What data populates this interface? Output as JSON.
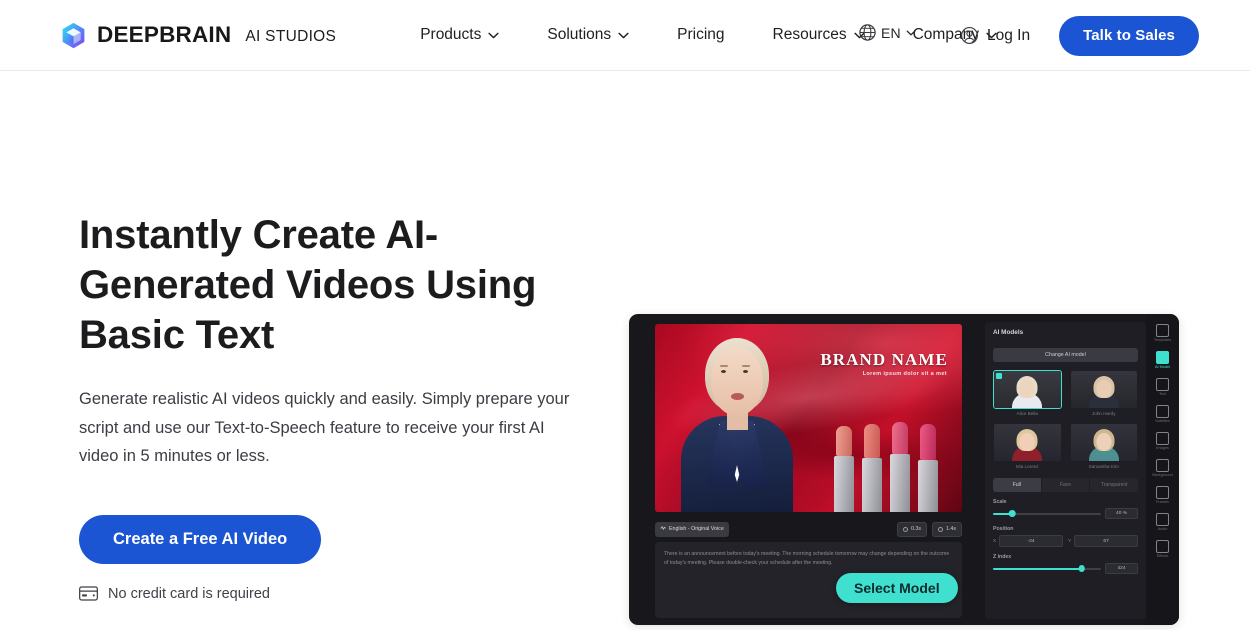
{
  "header": {
    "brand_name": "DEEPBRAIN",
    "brand_sub": "AI STUDIOS",
    "logo_icon": "cube-logo-icon",
    "nav": [
      {
        "label": "Products",
        "has_caret": true
      },
      {
        "label": "Solutions",
        "has_caret": true
      },
      {
        "label": "Pricing",
        "has_caret": false
      },
      {
        "label": "Resources",
        "has_caret": true
      },
      {
        "label": "Company",
        "has_caret": true
      }
    ],
    "language": {
      "label": "EN",
      "icon": "globe-icon"
    },
    "login": {
      "label": "Log In",
      "icon": "user-circle-icon"
    },
    "cta_sales": "Talk to Sales"
  },
  "hero": {
    "title": "Instantly Create AI-Generated Videos Using Basic Text",
    "subtitle": "Generate realistic AI videos quickly and easily. Simply prepare your script and use our Text-to-Speech feature to receive your first AI video in 5 minutes or less.",
    "cta_primary": "Create a Free AI Video",
    "no_card_note": "No credit card is required",
    "no_card_icon": "credit-card-icon"
  },
  "preview": {
    "stage": {
      "brand_title": "BRAND NAME",
      "brand_tagline": "Lorem ipsum dolor sit a met"
    },
    "toolbar": {
      "language_chip": "English - Original Voice",
      "language_chip_icon": "sound-wave-icon",
      "time_chips": [
        {
          "label": "0.3s",
          "icon": "clock-icon"
        },
        {
          "label": "1.4s",
          "icon": "clock-icon"
        }
      ]
    },
    "script": "There is an announcement before today's meeting. The morning schedule tomorrow may change depending on the outcome of today's meeting. Please double-check your schedule after the meeting.",
    "select_model_button": "Select Model",
    "panel": {
      "title": "AI Models",
      "change_model_button": "Change AI model",
      "models": [
        {
          "name": "Alice Bella",
          "selected": true,
          "skin": "#edd4bf",
          "hair": "#e8dcc8",
          "body": "#e9eaef"
        },
        {
          "name": "John Hardy",
          "selected": false,
          "skin": "#e8cdb4",
          "hair": "#d8c4a4",
          "body": "#2a2f3c"
        },
        {
          "name": "Mia Lorenz",
          "selected": false,
          "skin": "#f0cfb6",
          "hair": "#dfc79e",
          "body": "#8e1f2b"
        },
        {
          "name": "Samantha Kim",
          "selected": false,
          "skin": "#ecd0b8",
          "hair": "#cbb88f",
          "body": "#4e8f92"
        }
      ],
      "tabs": [
        {
          "label": "Full",
          "active": true
        },
        {
          "label": "Face",
          "active": false
        },
        {
          "label": "Transparent",
          "active": false
        }
      ],
      "controls": [
        {
          "label": "Scale",
          "type": "slider",
          "value": "40 %",
          "percent": 18
        },
        {
          "label": "Position",
          "type": "xy",
          "x_key": "X",
          "x_value": "-24",
          "y_key": "Y",
          "y_value": "67"
        },
        {
          "label": "Z index",
          "type": "slider",
          "value": "424",
          "percent": 82
        }
      ]
    },
    "rail": [
      {
        "label": "Templates",
        "icon": "template-icon",
        "active": false
      },
      {
        "label": "AI Model",
        "icon": "avatar-icon",
        "active": true
      },
      {
        "label": "Text",
        "icon": "text-icon",
        "active": false
      },
      {
        "label": "Subtitles",
        "icon": "subtitle-icon",
        "active": false
      },
      {
        "label": "Images",
        "icon": "image-icon",
        "active": false
      },
      {
        "label": "Background",
        "icon": "background-icon",
        "active": false
      },
      {
        "label": "Frames",
        "icon": "frame-icon",
        "active": false
      },
      {
        "label": "Audio",
        "icon": "audio-icon",
        "active": false
      },
      {
        "label": "Effects",
        "icon": "effects-icon",
        "active": false
      }
    ]
  },
  "colors": {
    "brand_blue": "#1b55d4",
    "accent_teal": "#3fe0d0",
    "text_dark": "#1c1c1e",
    "panel_dark": "#1e1e24"
  }
}
